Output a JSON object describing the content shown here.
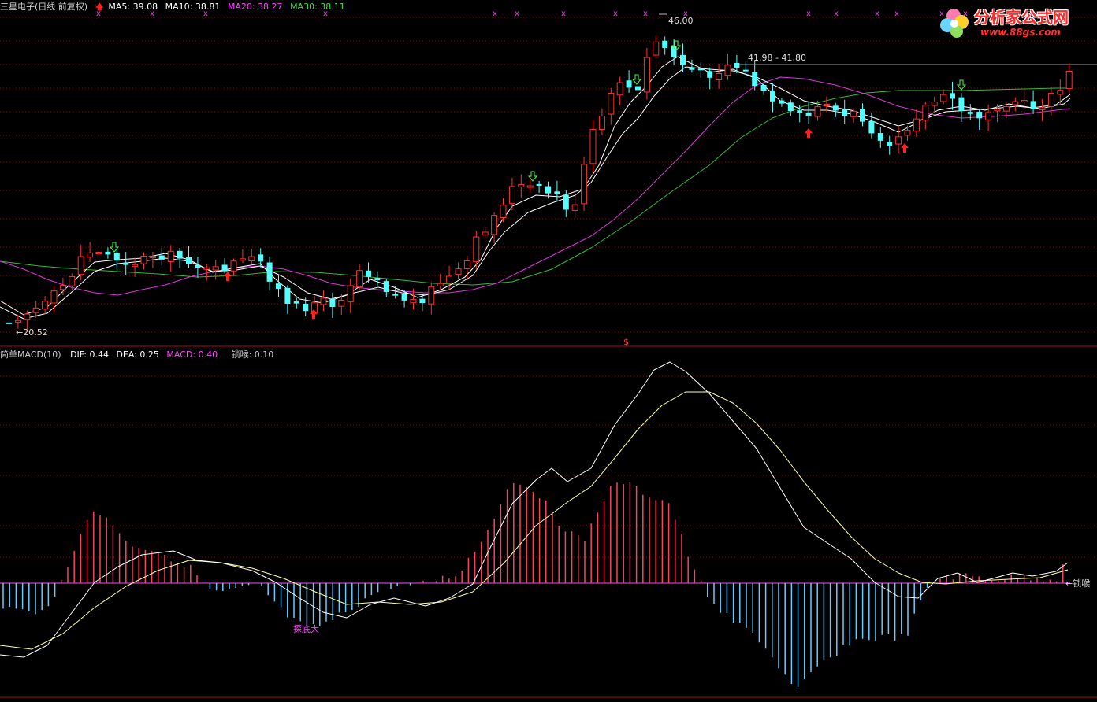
{
  "header": {
    "title": "三星电子(日线 前复权)",
    "ma_labels": [
      {
        "text": "MA5: 39.08",
        "color": "#ffffff"
      },
      {
        "text": "MA10: 38.81",
        "color": "#ffffff"
      },
      {
        "text": "MA20: 38.27",
        "color": "#ff44ff"
      },
      {
        "text": "MA30: 38.11",
        "color": "#44dd44"
      }
    ]
  },
  "watermark": {
    "brand": "分析家公式网",
    "url": "www.88gs.com"
  },
  "colors": {
    "up": "#ff3030",
    "down": "#54ffff",
    "ma_white": "#ffffff",
    "ma_pink": "#dd33dd",
    "ma_green": "#33bb33",
    "grid": "#7a1010",
    "divider": "#a01010",
    "dif": "#ffffff",
    "dea": "#ffffa0",
    "macd_pos": "#ff4060",
    "macd_neg": "#66ccff"
  },
  "chart_data": [
    {
      "type": "candlestick",
      "title": "三星电子(日线 前复权)",
      "series": [
        {
          "name": "MA5",
          "value": 39.08
        },
        {
          "name": "MA10",
          "value": 38.81
        },
        {
          "name": "MA20",
          "value": 38.27
        },
        {
          "name": "MA30",
          "value": 38.11
        }
      ],
      "ylim": [
        19.5,
        47
      ],
      "annotations": [
        {
          "text": "46.00",
          "kind": "high"
        },
        {
          "text": "41.98 - 41.80",
          "kind": "range"
        },
        {
          "text": "←20.52",
          "kind": "low"
        },
        {
          "text": "$",
          "kind": "marker"
        }
      ]
    },
    {
      "type": "line",
      "title": "简单MACD(10)",
      "series": [
        {
          "name": "DIF",
          "value": 0.44,
          "text": "DIF: 0.44"
        },
        {
          "name": "DEA",
          "value": 0.25,
          "text": "DEA: 0.25"
        },
        {
          "name": "MACD",
          "value": 0.4,
          "text": "MACD: 0.40"
        },
        {
          "name": "锁喉",
          "value": 0.1,
          "text": "锁喉: 0.10"
        }
      ],
      "annotations": [
        {
          "text": "探底大",
          "kind": "label"
        },
        {
          "text": "←锁喉",
          "kind": "label"
        }
      ]
    }
  ]
}
